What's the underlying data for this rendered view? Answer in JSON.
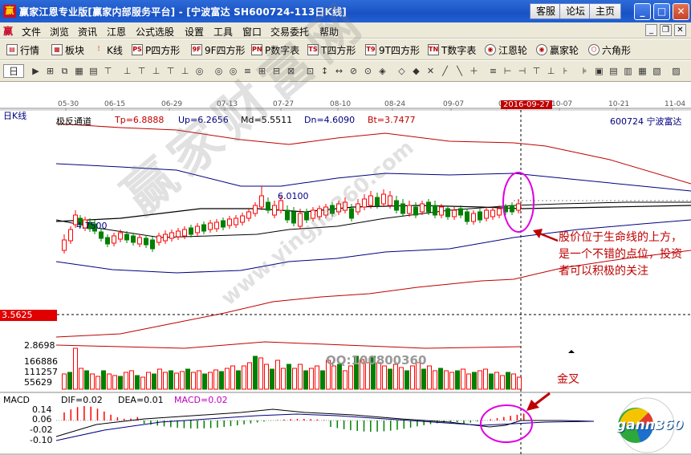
{
  "window": {
    "icon": "赢",
    "title": "赢家江恩专业版[赢家内部服务平台] - [宁波富达    SH600724-113日K线]",
    "buttons": {
      "service": "客服",
      "forum": "论坛",
      "home": "主页"
    }
  },
  "menu": {
    "items": [
      "文件",
      "浏览",
      "资讯",
      "江恩",
      "公式选股",
      "设置",
      "工具",
      "窗口",
      "交易委托",
      "帮助"
    ]
  },
  "toolbar1": {
    "items": [
      {
        "label": "行情",
        "icon": "quote-icon"
      },
      {
        "label": "板块",
        "icon": "sector-icon"
      },
      {
        "label": "K线",
        "icon": "kline-icon"
      },
      {
        "label": "P四方形",
        "icon_text": "PS"
      },
      {
        "label": "9F四方形",
        "icon_text": "9F"
      },
      {
        "label": "P数字表",
        "icon_text": "PN"
      },
      {
        "label": "T四方形",
        "icon_text": "TS"
      },
      {
        "label": "9T四方形",
        "icon_text": "T9"
      },
      {
        "label": "T数字表",
        "icon_text": "TN"
      },
      {
        "label": "江恩轮",
        "icon": "gann-wheel-icon"
      },
      {
        "label": "赢家轮",
        "icon": "winner-wheel-icon"
      },
      {
        "label": "六角形",
        "icon": "hexagon-icon"
      }
    ]
  },
  "toolbar2": {
    "period": "日",
    "icons": [
      "▶",
      "⊞",
      "⧉",
      "▦",
      "▤",
      "⊤",
      "⊥",
      "⊤",
      "⊥",
      "⊤",
      "⊥",
      "◎",
      "◎",
      "◎",
      "≡",
      "⊞",
      "⊟",
      "⊠",
      "⊡",
      "↕",
      "↔",
      "⊘",
      "⊙",
      "◈",
      "◇",
      "◆",
      "✕",
      "╱",
      "╲",
      "＋",
      "≡",
      "⊢",
      "⊣",
      "⊤",
      "⊥",
      "⊦",
      "⊧",
      "▣",
      "▤",
      "▥",
      "▦",
      "▧",
      "▨",
      "▩",
      "▪",
      "▫"
    ]
  },
  "chart": {
    "period_label": "日K线",
    "date_ticks": [
      "05-30",
      "06-15",
      "06-29",
      "07-13",
      "07-27",
      "08-10",
      "08-24",
      "09-07",
      "09-21",
      "2016-09-27",
      "10-07",
      "10-21",
      "11-04"
    ],
    "indicator": {
      "name": "极反通道",
      "tp": "Tp=6.8888",
      "up": "Up=6.2656",
      "md": "Md=5.5511",
      "dn": "Dn=4.6090",
      "bt": "Bt=3.7477"
    },
    "stock": "600724  宁波富达",
    "price_high_label": "6.0100",
    "price_low_label": "4.7500",
    "cursor_price": "3.5625",
    "volume_labels": [
      "2.8698",
      "166886",
      "111257",
      "55629"
    ],
    "qq": "QQ:100800360",
    "annotation_main": "股价位于生命线的上方，是一个不错的点位，投资者可以积极的关注",
    "annotation_cross": "金叉",
    "macd": {
      "name": "MACD",
      "dif": "DIF=0.02",
      "dea": "DEA=0.01",
      "macd": "MACD=0.02",
      "yticks": [
        "0.14",
        "0.06",
        "-0.02",
        "-0.10"
      ]
    },
    "watermark": "赢家财富网",
    "watermark2": "www.yingjia360.com",
    "logo": "gann360",
    "colors": {
      "up": "#ff0000",
      "down": "#008000",
      "channel_outer": "#c00000",
      "channel_mid": "#000080",
      "center": "#000000",
      "annotation": "#c00000",
      "circle": "#e000e0"
    }
  }
}
